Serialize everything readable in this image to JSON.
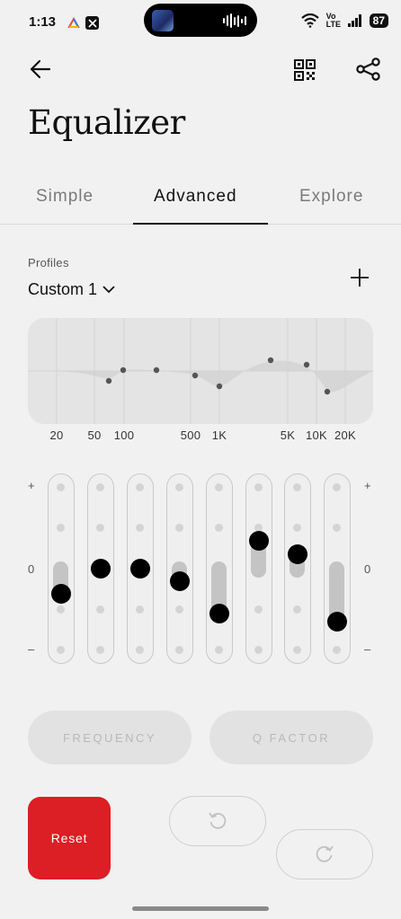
{
  "status_bar": {
    "time": "1:13",
    "network": "Vo LTE",
    "battery": "87"
  },
  "header": {
    "title": "Equalizer",
    "back_icon": "arrow-left-icon",
    "qr_icon": "qr-code-icon",
    "share_icon": "share-icon"
  },
  "tabs": [
    {
      "label": "Simple",
      "active": false
    },
    {
      "label": "Advanced",
      "active": true
    },
    {
      "label": "Explore",
      "active": false
    }
  ],
  "profiles": {
    "label": "Profiles",
    "selected": "Custom 1",
    "add_icon": "plus-icon"
  },
  "curve": {
    "frequency_labels": [
      "20",
      "50",
      "100",
      "500",
      "1K",
      "5K",
      "10K",
      "20K"
    ]
  },
  "equalizer": {
    "plus_label": "+",
    "zero_label": "0",
    "minus_label": "–",
    "bands_gain_fraction": [
      -0.32,
      0.0,
      0.0,
      -0.16,
      -0.56,
      0.34,
      0.17,
      -0.66
    ]
  },
  "controls": {
    "frequency_label": "FREQUENCY",
    "q_factor_label": "Q FACTOR",
    "reset_label": "Reset",
    "undo_icon": "undo-icon",
    "redo_icon": "redo-icon"
  },
  "colors": {
    "accent_red": "#dc1e25",
    "knob": "#000000",
    "background": "#f1f1f1"
  }
}
